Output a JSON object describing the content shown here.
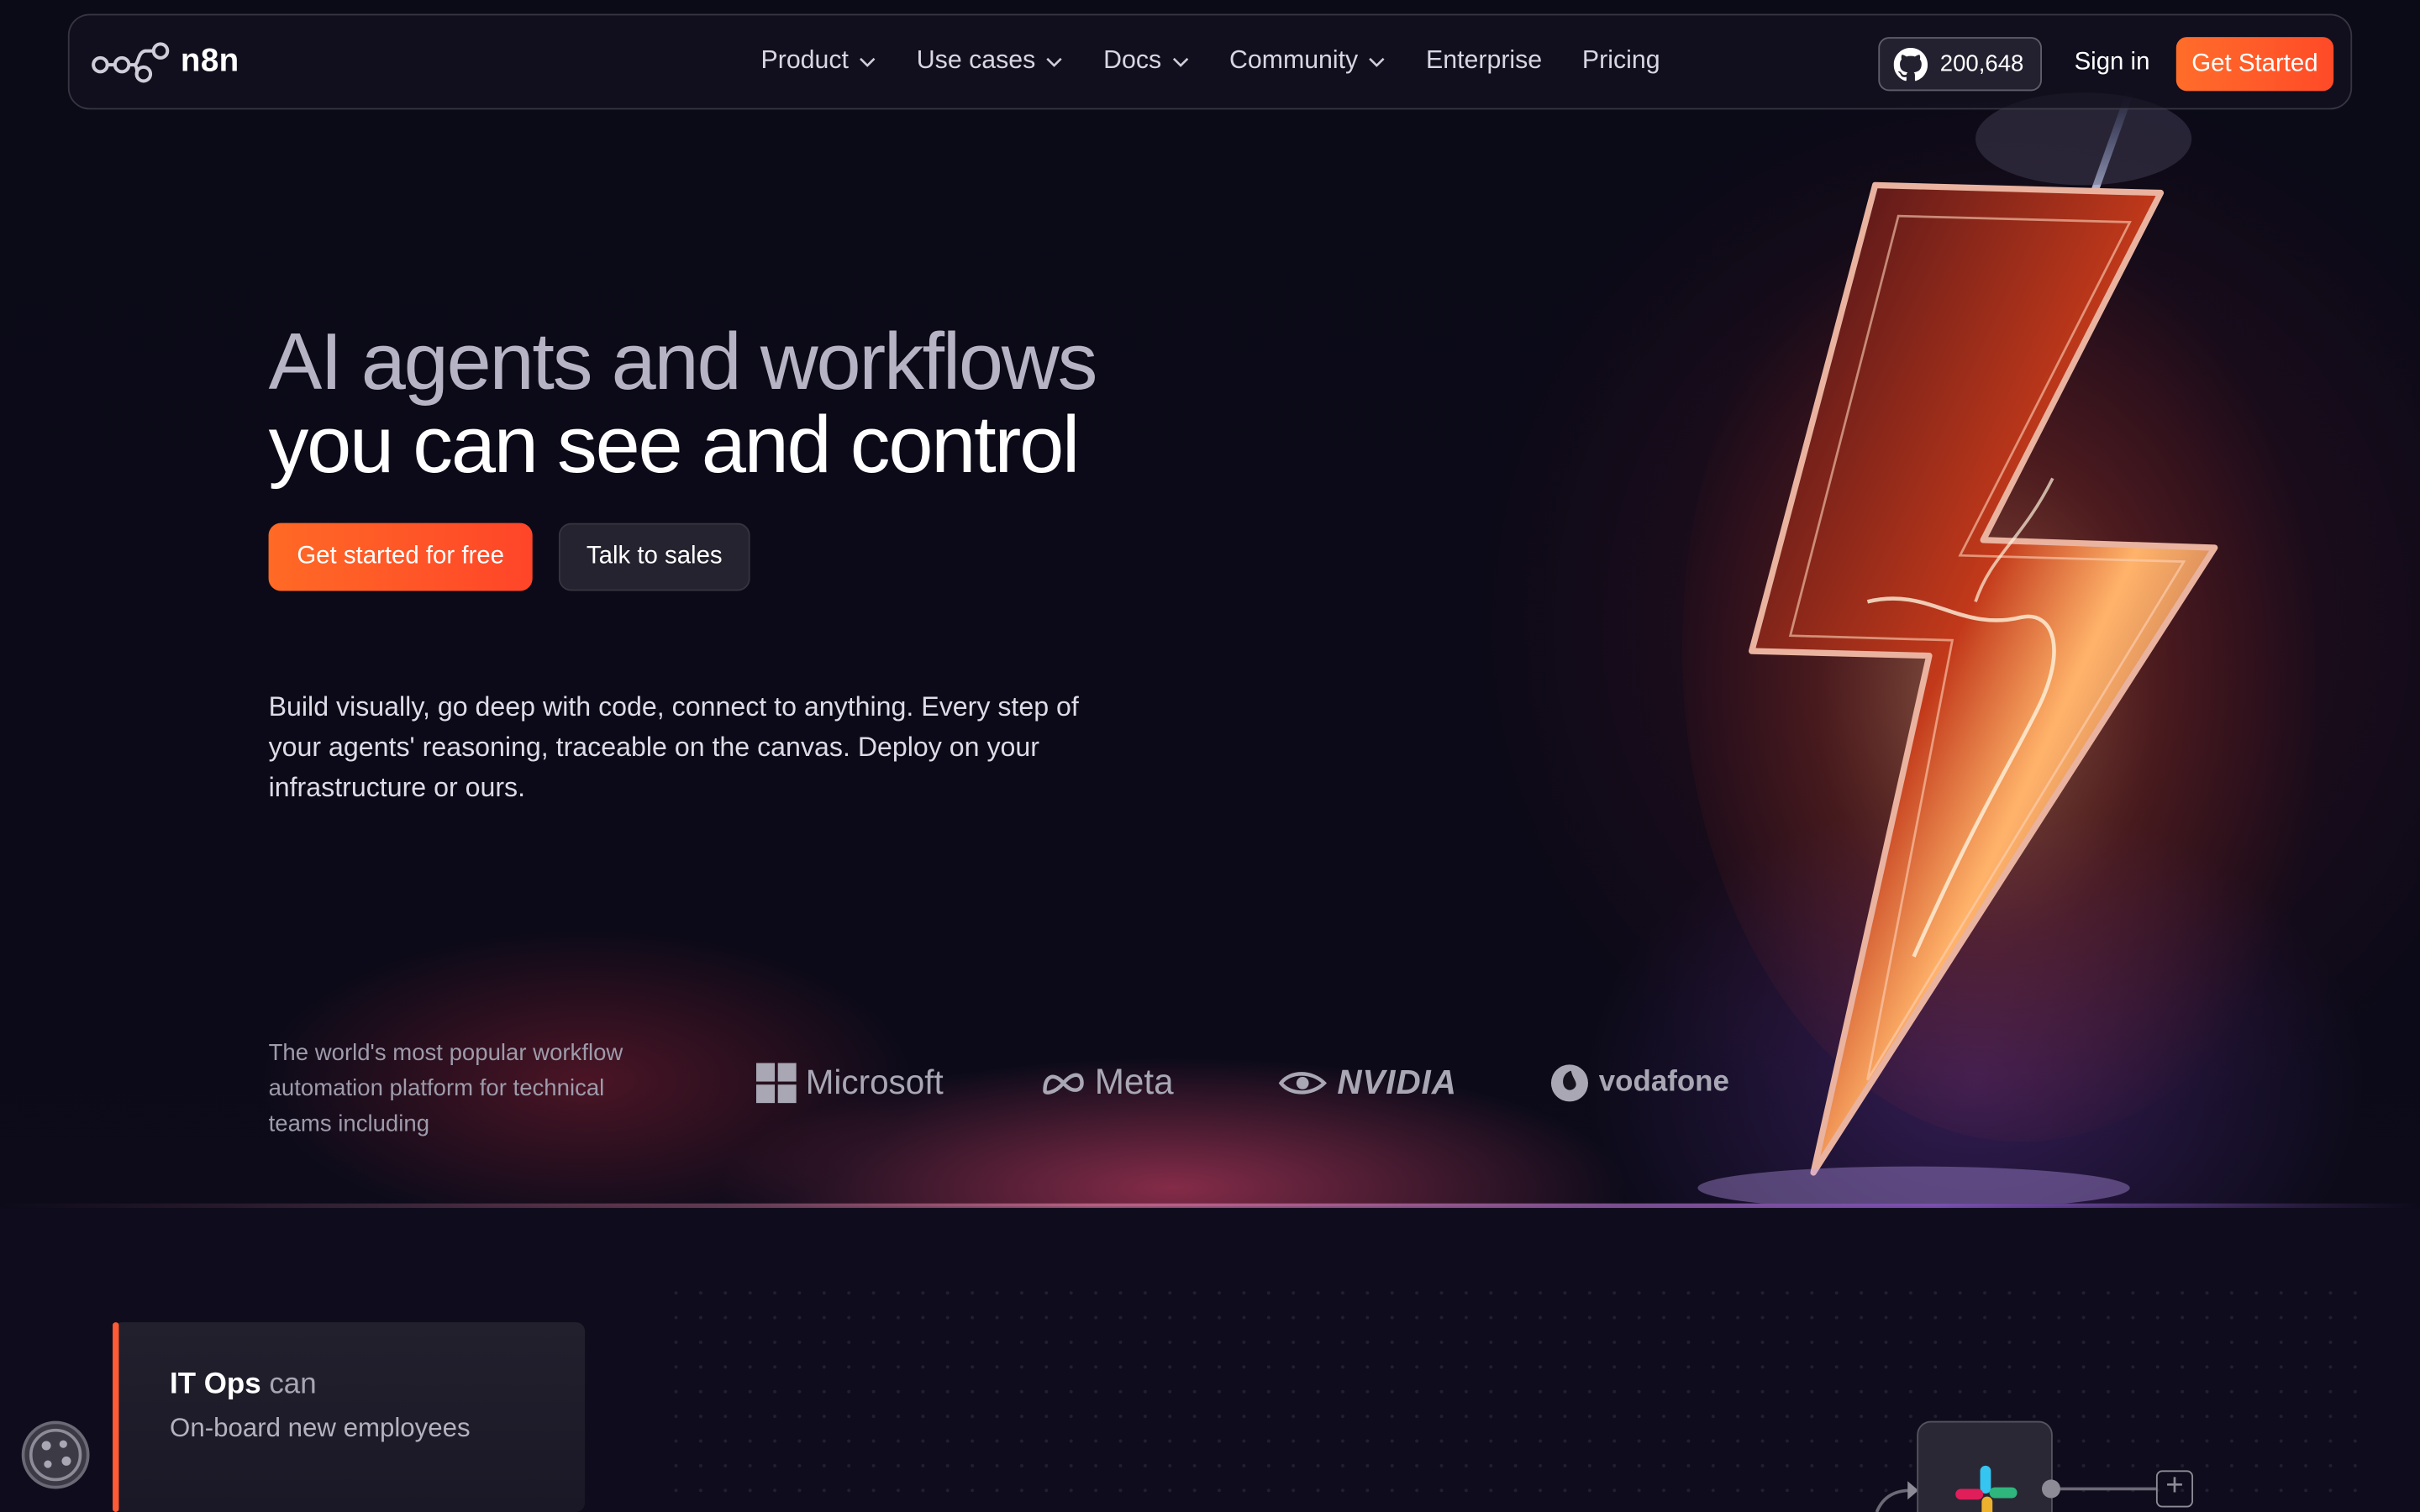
{
  "nav": {
    "logo_text": "n8n",
    "links": [
      {
        "label": "Product",
        "has_dropdown": true
      },
      {
        "label": "Use cases",
        "has_dropdown": true
      },
      {
        "label": "Docs",
        "has_dropdown": true
      },
      {
        "label": "Community",
        "has_dropdown": true
      },
      {
        "label": "Enterprise",
        "has_dropdown": false
      },
      {
        "label": "Pricing",
        "has_dropdown": false
      }
    ],
    "github_stars": "200,648",
    "sign_in": "Sign in",
    "get_started": "Get Started"
  },
  "hero": {
    "headline_line1": "AI agents and workflows",
    "headline_line2": "you can see and control",
    "cta_primary": "Get started for free",
    "cta_secondary": "Talk to sales",
    "description": "Build visually, go deep with code, connect to anything. Every step of your agents' reasoning, traceable on the canvas. Deploy on your infrastructure or ours."
  },
  "trust": {
    "text": "The world's most popular workflow automation platform for technical teams including",
    "logos": [
      "Microsoft",
      "Meta",
      "NVIDIA",
      "vodafone"
    ]
  },
  "use_case_card": {
    "role": "IT Ops",
    "connector": "can",
    "task": "On-board new employees"
  },
  "colors": {
    "accent": "#ff5b2e",
    "background": "#0e0b1b"
  },
  "icons": [
    "github-icon",
    "chevron-down-icon",
    "cookie-icon",
    "slack-icon",
    "plus-icon"
  ]
}
